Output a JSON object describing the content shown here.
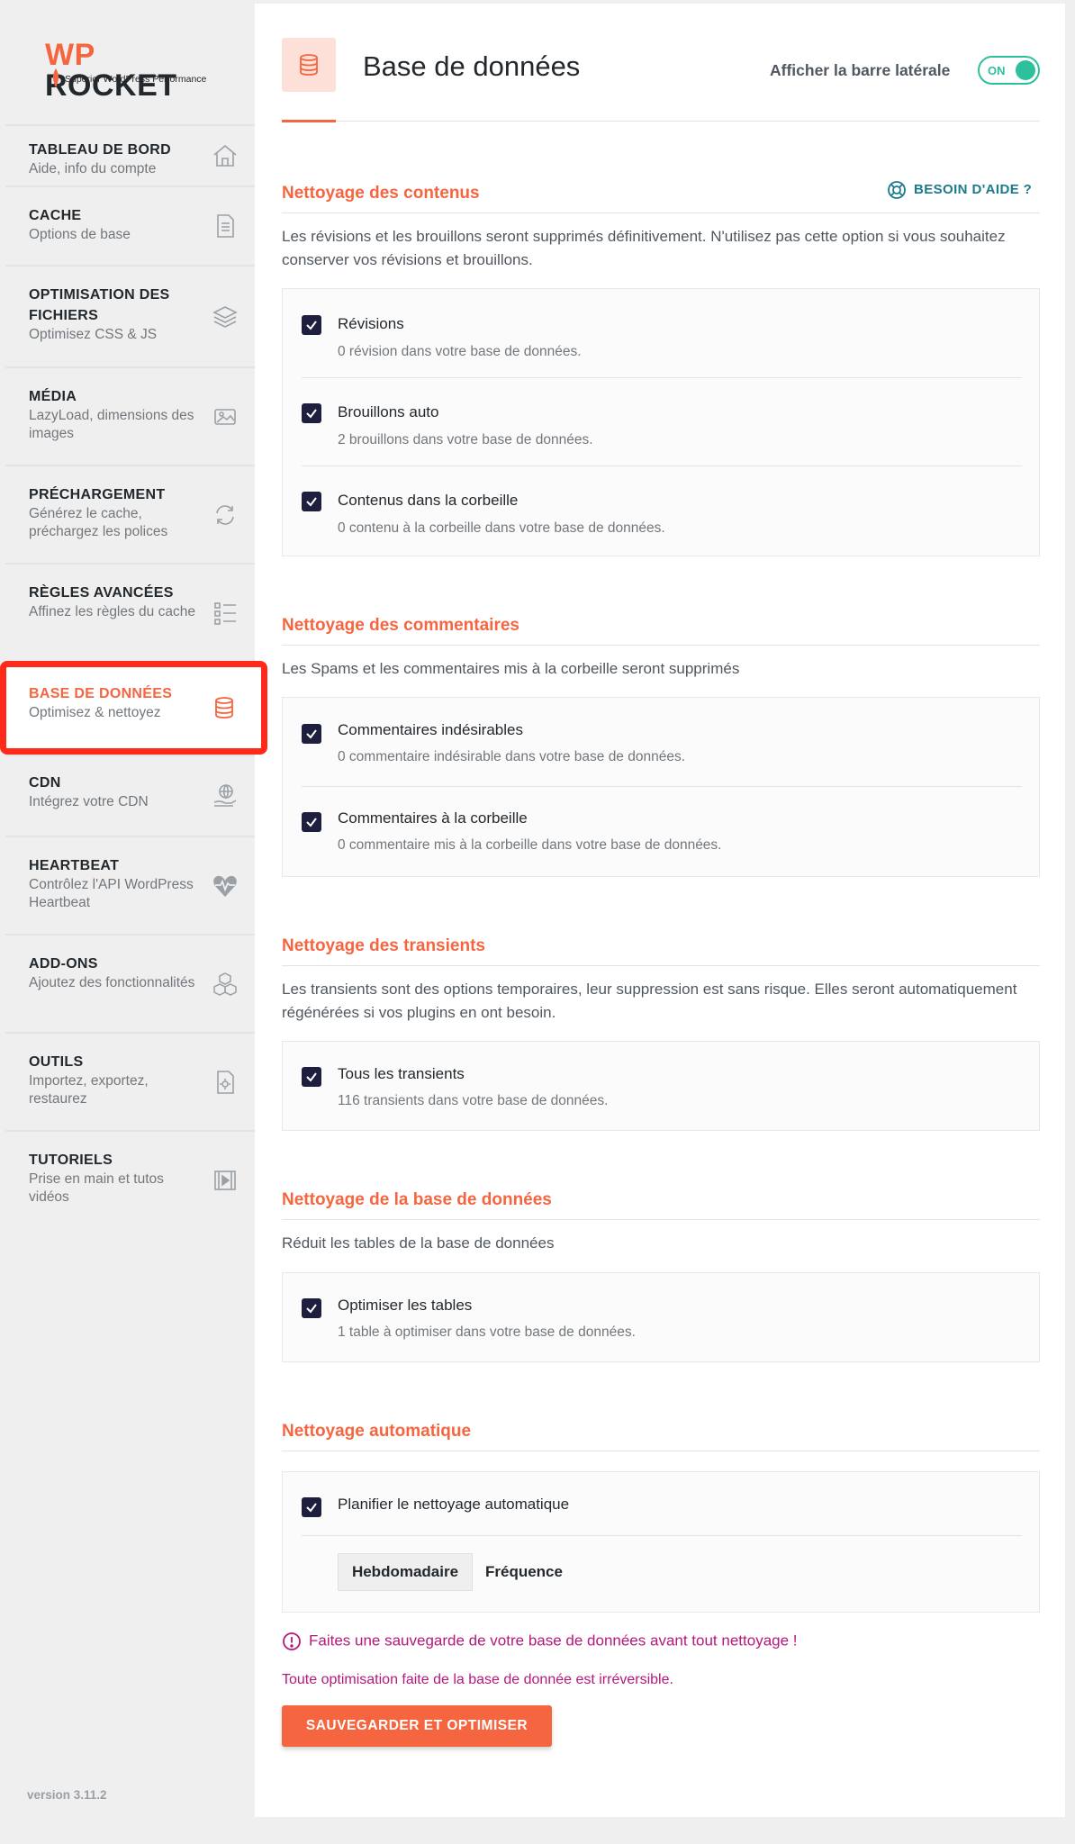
{
  "logo": {
    "wp": "WP",
    "rocket": "ROCKET",
    "tagline": "Superior WordPress Performance"
  },
  "sidebar": {
    "items": [
      {
        "title": "TABLEAU DE BORD",
        "sub": "Aide, info du compte",
        "icon": "home-icon"
      },
      {
        "title": "CACHE",
        "sub": "Options de base",
        "icon": "document-icon"
      },
      {
        "title": "OPTIMISATION DES FICHIERS",
        "sub": "Optimisez CSS & JS",
        "icon": "layers-icon"
      },
      {
        "title": "MÉDIA",
        "sub": "LazyLoad, dimensions des images",
        "icon": "image-icon"
      },
      {
        "title": "PRÉCHARGEMENT",
        "sub": "Générez le cache, préchargez les polices",
        "icon": "refresh-icon"
      },
      {
        "title": "RÈGLES AVANCÉES",
        "sub": "Affinez les règles du cache",
        "icon": "checklist-icon"
      },
      {
        "title": "BASE DE DONNÉES",
        "sub": "Optimisez & nettoyez",
        "icon": "database-icon",
        "active": true
      },
      {
        "title": "CDN",
        "sub": "Intégrez votre CDN",
        "icon": "globe-hand-icon"
      },
      {
        "title": "HEARTBEAT",
        "sub": "Contrôlez l'API WordPress Heartbeat",
        "icon": "heartbeat-icon"
      },
      {
        "title": "ADD-ONS",
        "sub": "Ajoutez des fonctionnalités",
        "icon": "cubes-icon"
      },
      {
        "title": "OUTILS",
        "sub": "Importez, exportez, restaurez",
        "icon": "file-gear-icon"
      },
      {
        "title": "TUTORIELS",
        "sub": "Prise en main et tutos vidéos",
        "icon": "video-icon"
      }
    ],
    "version": "version 3.11.2"
  },
  "header": {
    "title": "Base de données",
    "sidebar_toggle_label": "Afficher la barre latérale",
    "toggle_state": "ON"
  },
  "help_label": "BESOIN D'AIDE ?",
  "sections": {
    "contenus": {
      "title": "Nettoyage des contenus",
      "desc": "Les révisions et les brouillons seront supprimés définitivement. N'utilisez pas cette option si vous souhaitez conserver vos révisions et brouillons.",
      "options": [
        {
          "label": "Révisions",
          "sub": "0 révision dans votre base de données.",
          "checked": true
        },
        {
          "label": "Brouillons auto",
          "sub": "2 brouillons dans votre base de données.",
          "checked": true
        },
        {
          "label": "Contenus dans la corbeille",
          "sub": "0 contenu à la corbeille dans votre base de données.",
          "checked": true
        }
      ]
    },
    "commentaires": {
      "title": "Nettoyage des commentaires",
      "desc": "Les Spams et les commentaires mis à la corbeille seront supprimés",
      "options": [
        {
          "label": "Commentaires indésirables",
          "sub": "0 commentaire indésirable dans votre base de données.",
          "checked": true
        },
        {
          "label": "Commentaires à la corbeille",
          "sub": "0 commentaire mis à la corbeille dans votre base de données.",
          "checked": true
        }
      ]
    },
    "transients": {
      "title": "Nettoyage des transients",
      "desc": "Les transients sont des options temporaires, leur suppression est sans risque. Elles seront automatiquement régénérées si vos plugins en ont besoin.",
      "options": [
        {
          "label": "Tous les transients",
          "sub": "116 transients dans votre base de données.",
          "checked": true
        }
      ]
    },
    "base": {
      "title": "Nettoyage de la base de données",
      "desc": "Réduit les tables de la base de données",
      "options": [
        {
          "label": "Optimiser les tables",
          "sub": "1 table à optimiser dans votre base de données.",
          "checked": true
        }
      ]
    },
    "auto": {
      "title": "Nettoyage automatique",
      "options": [
        {
          "label": "Planifier le nettoyage automatique",
          "checked": true
        }
      ],
      "frequency_value": "Hebdomadaire",
      "frequency_label": "Fréquence"
    }
  },
  "warning": "Faites une sauvegarde de votre base de données avant tout nettoyage !",
  "warning2": "Toute optimisation faite de la base de donnée est irréversible.",
  "submit_label": "SAUVEGARDER ET OPTIMISER",
  "colors": {
    "accent": "#f56640",
    "toggle": "#2ec09c",
    "warning": "#b5197c",
    "checkbox": "#1e1e3f",
    "help": "#1b7a8c"
  }
}
